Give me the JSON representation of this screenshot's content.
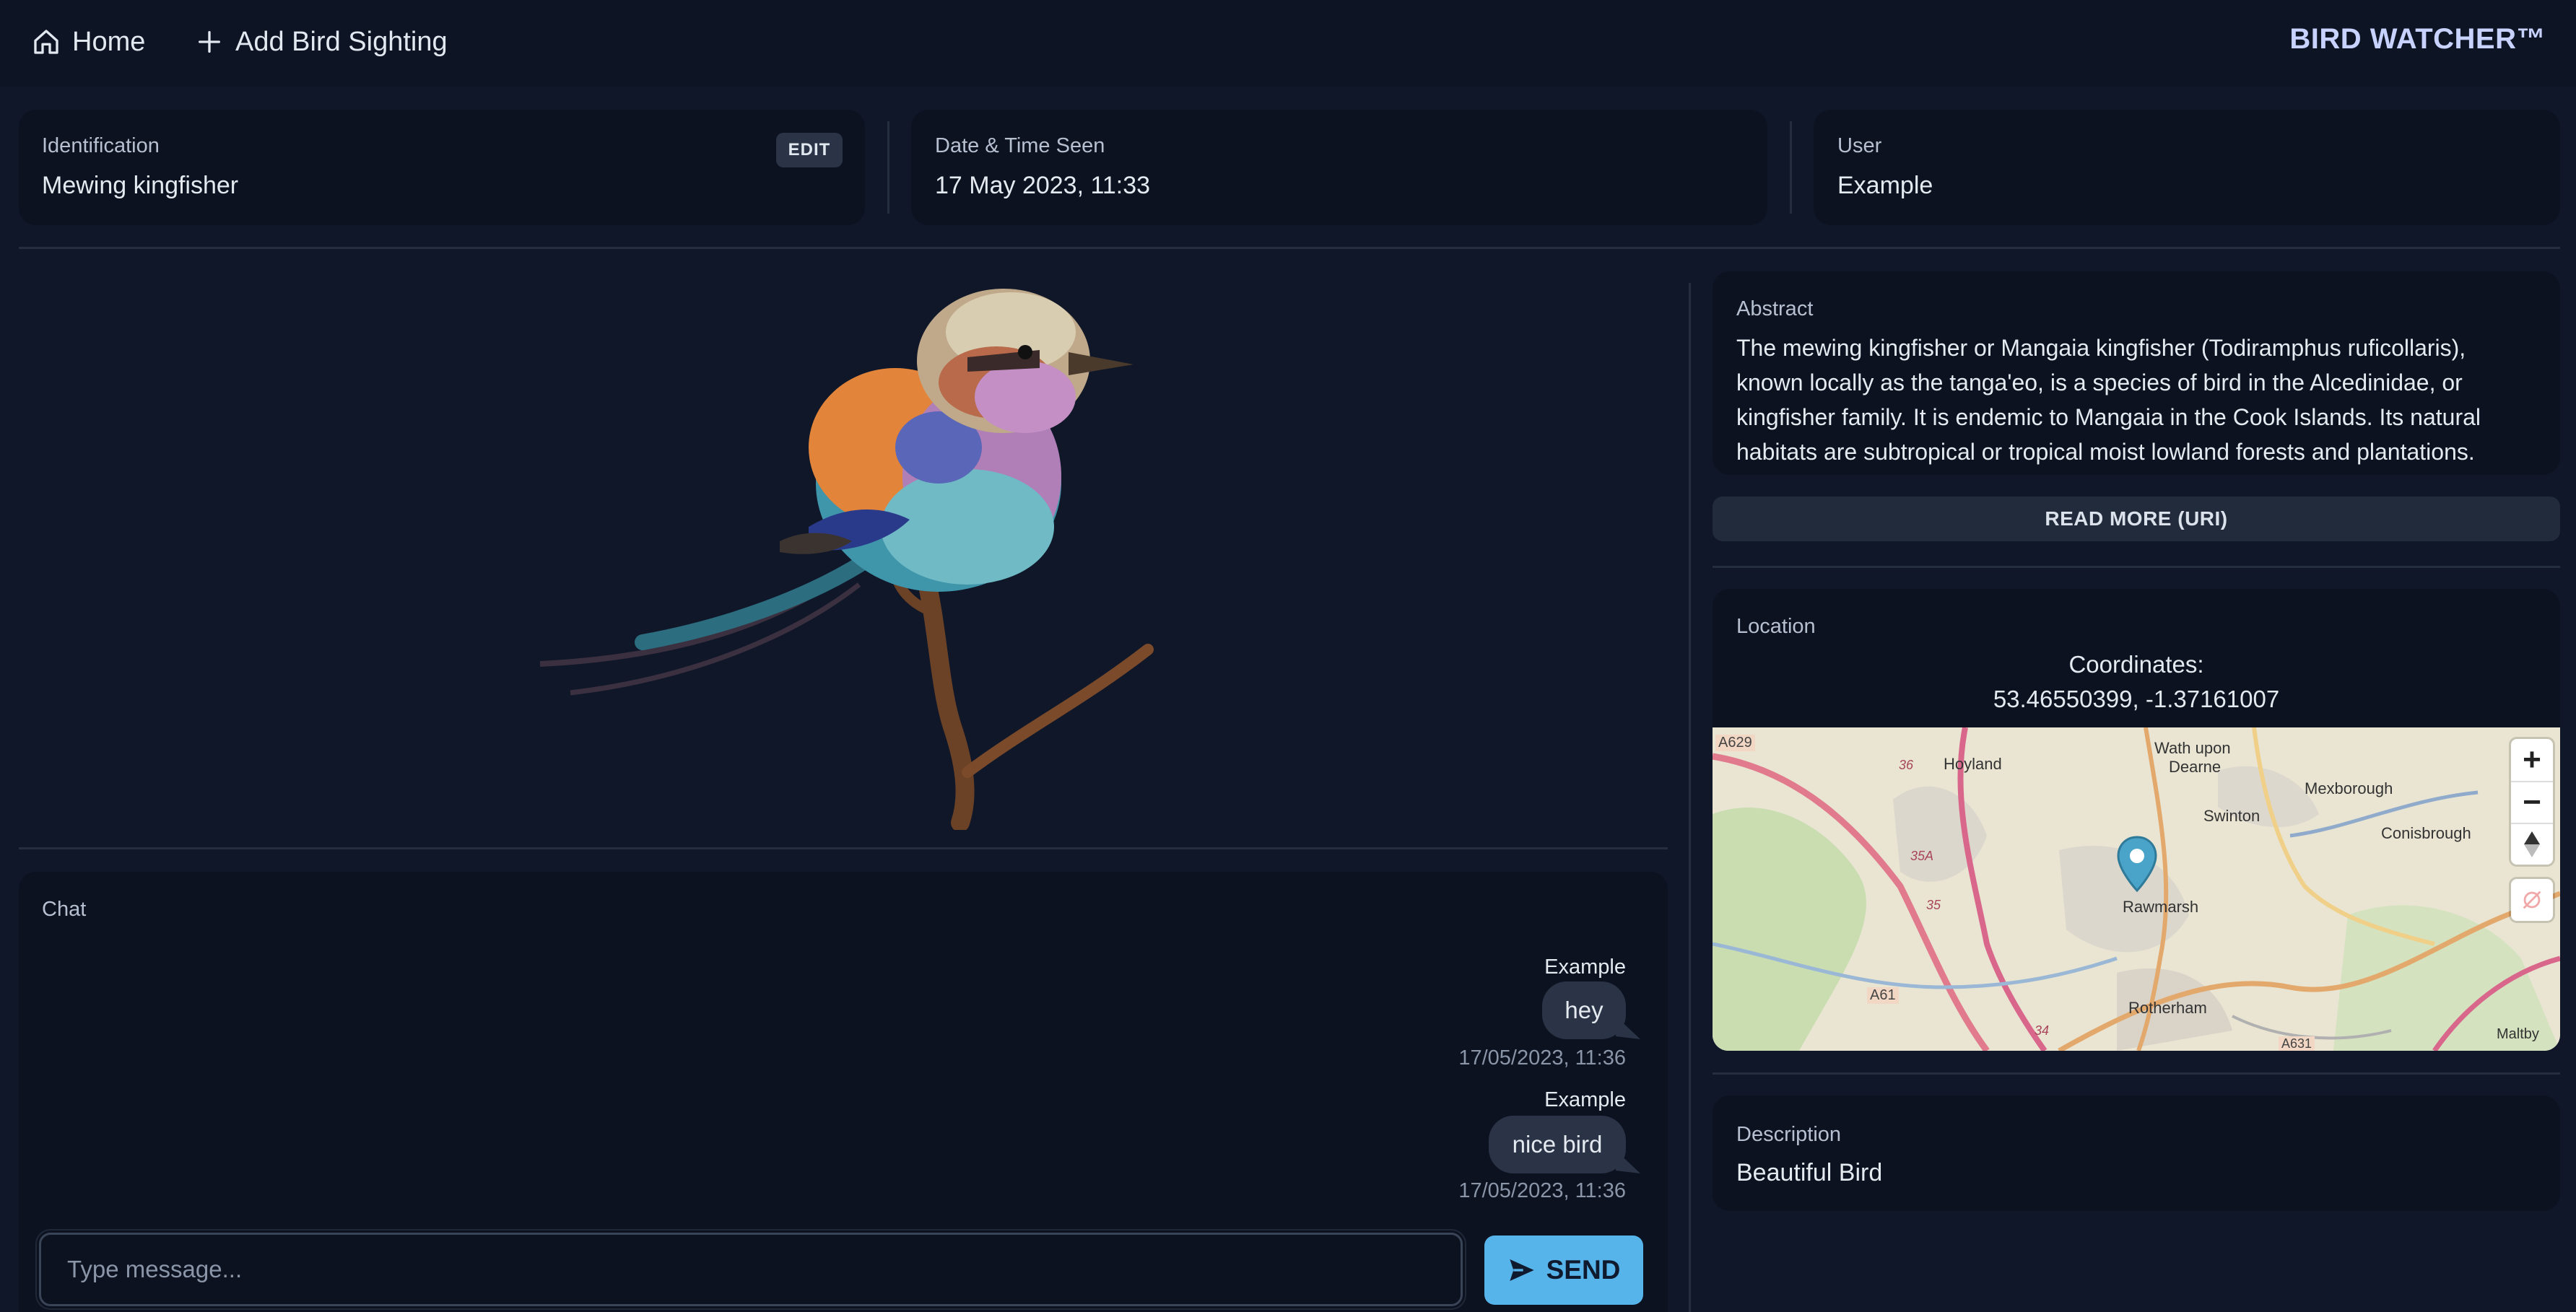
{
  "nav": {
    "home_label": "Home",
    "add_label": "Add Bird Sighting",
    "brand": "BIRD WATCHER™"
  },
  "info": {
    "identification_label": "Identification",
    "identification_value": "Mewing kingfisher",
    "edit_label": "EDIT",
    "date_label": "Date & Time Seen",
    "date_value": "17 May 2023, 11:33",
    "user_label": "User",
    "user_value": "Example"
  },
  "abstract": {
    "label": "Abstract",
    "text": "The mewing kingfisher or Mangaia kingfisher (Todiramphus ruficollaris), known locally as the tanga'eo, is a species of bird in the Alcedinidae, or kingfisher family. It is endemic to Mangaia in the Cook Islands. Its natural habitats are subtropical or tropical moist lowland forests and plantations.",
    "read_more_label": "READ MORE (URI)"
  },
  "location": {
    "label": "Location",
    "coordinates_label": "Coordinates:",
    "coordinates_value": "53.46550399, -1.37161007",
    "map_places": [
      "A629",
      "Hoyland",
      "Wath upon",
      "Dearne",
      "Mexborough",
      "Swinton",
      "Conisbrough",
      "Rawmarsh",
      "A61",
      "Rotherham",
      "Maltby",
      "36",
      "35A",
      "35",
      "34",
      "A631"
    ],
    "zoom_in": "+",
    "zoom_out": "−"
  },
  "description": {
    "label": "Description",
    "value": "Beautiful Bird"
  },
  "chat": {
    "label": "Chat",
    "messages": [
      {
        "author": "Example",
        "text": "hey",
        "time": "17/05/2023, 11:36"
      },
      {
        "author": "Example",
        "text": "nice bird",
        "time": "17/05/2023, 11:36"
      }
    ],
    "input_placeholder": "Type message...",
    "send_label": "SEND"
  },
  "colors": {
    "background": "#0f1729",
    "card": "#0c1220",
    "accent": "#56b4ea",
    "map_pin": "#4aa3c9"
  }
}
